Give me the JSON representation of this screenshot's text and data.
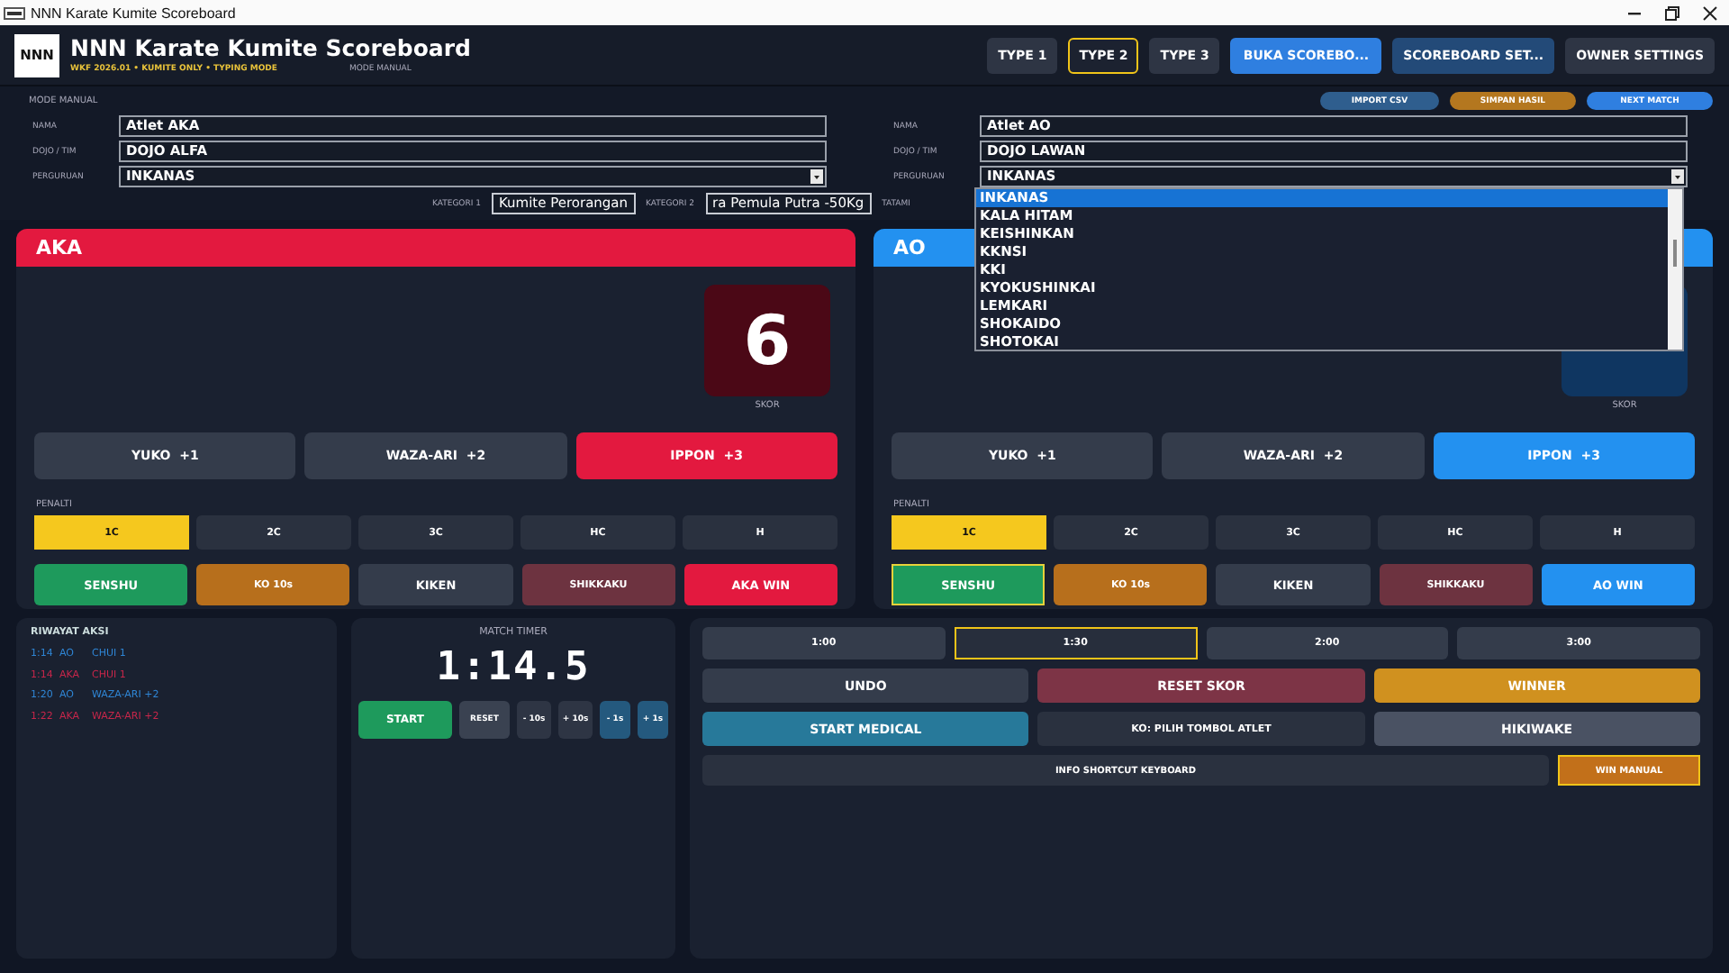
{
  "window": {
    "title": "NNN Karate Kumite Scoreboard"
  },
  "header": {
    "logo": "NNN",
    "title": "NNN Karate Kumite Scoreboard",
    "subtitle": "WKF 2026.01 • KUMITE ONLY • TYPING MODE",
    "mode": "MODE MANUAL",
    "type_tabs": [
      {
        "label": "TYPE 1",
        "selected": false
      },
      {
        "label": "TYPE 2",
        "selected": true
      },
      {
        "label": "TYPE 3",
        "selected": false
      }
    ],
    "buttons": [
      {
        "label": "BUKA SCOREBO...",
        "kind": "primary"
      },
      {
        "label": "SCOREBOARD SET...",
        "kind": "secondary"
      },
      {
        "label": "OWNER SETTINGS",
        "kind": "plain"
      }
    ]
  },
  "setup": {
    "mode": "MODE MANUAL",
    "actions": [
      {
        "label": "IMPORT CSV",
        "kind": "secondary"
      },
      {
        "label": "SIMPAN HASIL",
        "kind": "warning"
      },
      {
        "label": "NEXT MATCH",
        "kind": "primary"
      }
    ],
    "aka": [
      {
        "label": "NAMA",
        "value": "Atlet AKA",
        "kind": "text"
      },
      {
        "label": "DOJO / TIM",
        "value": "DOJO ALFA",
        "kind": "text"
      },
      {
        "label": "PERGURUAN",
        "value": "INKANAS",
        "kind": "dropdown"
      }
    ],
    "ao": [
      {
        "label": "NAMA",
        "value": "Atlet AO",
        "kind": "text"
      },
      {
        "label": "DOJO / TIM",
        "value": "DOJO LAWAN",
        "kind": "text"
      },
      {
        "label": "PERGURUAN",
        "value": "INKANAS",
        "kind": "dropdown"
      }
    ],
    "categories": [
      {
        "label": "KATEGORI 1",
        "value": "Kumite Perorangan"
      },
      {
        "label": "KATEGORI 2",
        "value": "ra Pemula Putra -50Kg"
      },
      {
        "label": "TATAMI"
      }
    ]
  },
  "dropdown": {
    "options": [
      {
        "label": "INKANAS",
        "selected": true
      },
      {
        "label": "KALA HITAM",
        "selected": false
      },
      {
        "label": "KEISHINKAN",
        "selected": false
      },
      {
        "label": "KKNSI",
        "selected": false
      },
      {
        "label": "KKI",
        "selected": false
      },
      {
        "label": "KYOKUSHINKAI",
        "selected": false
      },
      {
        "label": "LEMKARI",
        "selected": false
      },
      {
        "label": "SHOKAIDO",
        "selected": false
      },
      {
        "label": "SHOTOKAI",
        "selected": false
      }
    ]
  },
  "athletes": [
    {
      "name": "AKA",
      "kind": "aka",
      "score": "6",
      "score_label": "SKOR",
      "scores": [
        {
          "label": "YUKO  +1",
          "kind": "plain"
        },
        {
          "label": "WAZA-ARI  +2",
          "kind": "plain"
        },
        {
          "label": "IPPON  +3",
          "kind": "accent"
        }
      ],
      "penalty_label": "PENALTI",
      "penalties": [
        {
          "label": "1C",
          "selected": true
        },
        {
          "label": "2C",
          "selected": false
        },
        {
          "label": "3C",
          "selected": false
        },
        {
          "label": "HC",
          "selected": false
        },
        {
          "label": "H",
          "selected": false
        }
      ],
      "actions": [
        {
          "label": "SENSHU",
          "kind": "senshu",
          "selected": false
        },
        {
          "label": "KO 10s",
          "kind": "ko",
          "selected": false
        },
        {
          "label": "KIKEN",
          "kind": "plain",
          "selected": false
        },
        {
          "label": "SHIKKAKU",
          "kind": "shikkaku",
          "selected": false
        },
        {
          "label": "AKA WIN",
          "kind": "accent",
          "selected": false
        }
      ]
    },
    {
      "name": "AO",
      "kind": "ao",
      "score_label": "SKOR",
      "scores": [
        {
          "label": "YUKO  +1",
          "kind": "plain"
        },
        {
          "label": "WAZA-ARI  +2",
          "kind": "plain"
        },
        {
          "label": "IPPON  +3",
          "kind": "accent"
        }
      ],
      "penalty_label": "PENALTI",
      "penalties": [
        {
          "label": "1C",
          "selected": true
        },
        {
          "label": "2C",
          "selected": false
        },
        {
          "label": "3C",
          "selected": false
        },
        {
          "label": "HC",
          "selected": false
        },
        {
          "label": "H",
          "selected": false
        }
      ],
      "actions": [
        {
          "label": "SENSHU",
          "kind": "senshu",
          "selected": true
        },
        {
          "label": "KO 10s",
          "kind": "ko",
          "selected": false
        },
        {
          "label": "KIKEN",
          "kind": "plain",
          "selected": false
        },
        {
          "label": "SHIKKAKU",
          "kind": "shikkaku",
          "selected": false
        },
        {
          "label": "AO WIN",
          "kind": "accent",
          "selected": false
        }
      ]
    }
  ],
  "history": {
    "title": "RIWAYAT AKSI",
    "entries": [
      {
        "time": "1:14",
        "side": "AO",
        "action": "CHUI 1",
        "color": "#2f86d6"
      },
      {
        "time": "1:14",
        "side": "AKA",
        "action": "CHUI 1",
        "color": "#c8264a"
      },
      {
        "time": "1:20",
        "side": "AO",
        "action": "WAZA-ARI +2",
        "color": "#2f86d6"
      },
      {
        "time": "1:22",
        "side": "AKA",
        "action": "WAZA-ARI +2",
        "color": "#c8264a"
      }
    ]
  },
  "timer": {
    "title": "MATCH TIMER",
    "time": "1:14.5",
    "buttons": [
      {
        "label": "START",
        "kind": "start"
      },
      {
        "label": "RESET",
        "kind": "plain"
      },
      {
        "label": "- 10s",
        "kind": "small"
      },
      {
        "label": "+ 10s",
        "kind": "small"
      },
      {
        "label": "- 1s",
        "kind": "teal"
      },
      {
        "label": "+ 1s",
        "kind": "teal"
      }
    ]
  },
  "controls": {
    "presets": [
      {
        "label": "1:00",
        "selected": false
      },
      {
        "label": "1:30",
        "selected": true
      },
      {
        "label": "2:00",
        "selected": false
      },
      {
        "label": "3:00",
        "selected": false
      }
    ],
    "rows": [
      [
        {
          "label": "UNDO",
          "kind": "plain"
        },
        {
          "label": "RESET SKOR",
          "kind": "danger"
        },
        {
          "label": "WINNER",
          "kind": "warning"
        }
      ],
      [
        {
          "label": "START MEDICAL",
          "kind": "medical"
        },
        {
          "label": "KO: PILIH TOMBOL ATLET",
          "kind": "dark"
        },
        {
          "label": "HIKIWAKE",
          "kind": "neutral"
        }
      ]
    ],
    "info": "INFO SHORTCUT KEYBOARD",
    "win_manual": "WIN MANUAL"
  }
}
